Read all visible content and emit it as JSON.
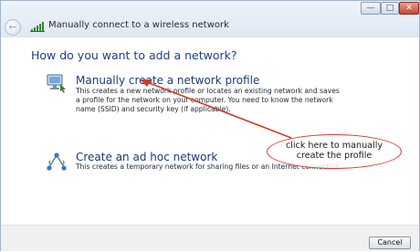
{
  "window": {
    "title": "Manually connect to a wireless network",
    "controls": {
      "minimize": "—",
      "maximize": "□",
      "close": "✕"
    },
    "back_glyph": "←"
  },
  "main": {
    "heading": "How do you want to add a network?",
    "options": [
      {
        "title": "Manually create a network profile",
        "description_lines": [
          "This creates a new network profile or locates an existing network and saves",
          "a profile for the network on your computer. You need to know the network",
          "name (SSID) and security key (if applicable)."
        ],
        "icon": "network-profile-icon"
      },
      {
        "title": "Create an ad hoc network",
        "description_lines": [
          "This creates a temporary network for sharing files or an Internet connection"
        ],
        "icon": "ad-hoc-network-icon"
      }
    ]
  },
  "annotation": {
    "lines": [
      "click here to manually",
      "create the profile"
    ],
    "color": "#d03a2c"
  },
  "footer": {
    "cancel_label": "Cancel"
  },
  "colors": {
    "heading": "#1e3f80",
    "link_title": "#1b3a78"
  }
}
